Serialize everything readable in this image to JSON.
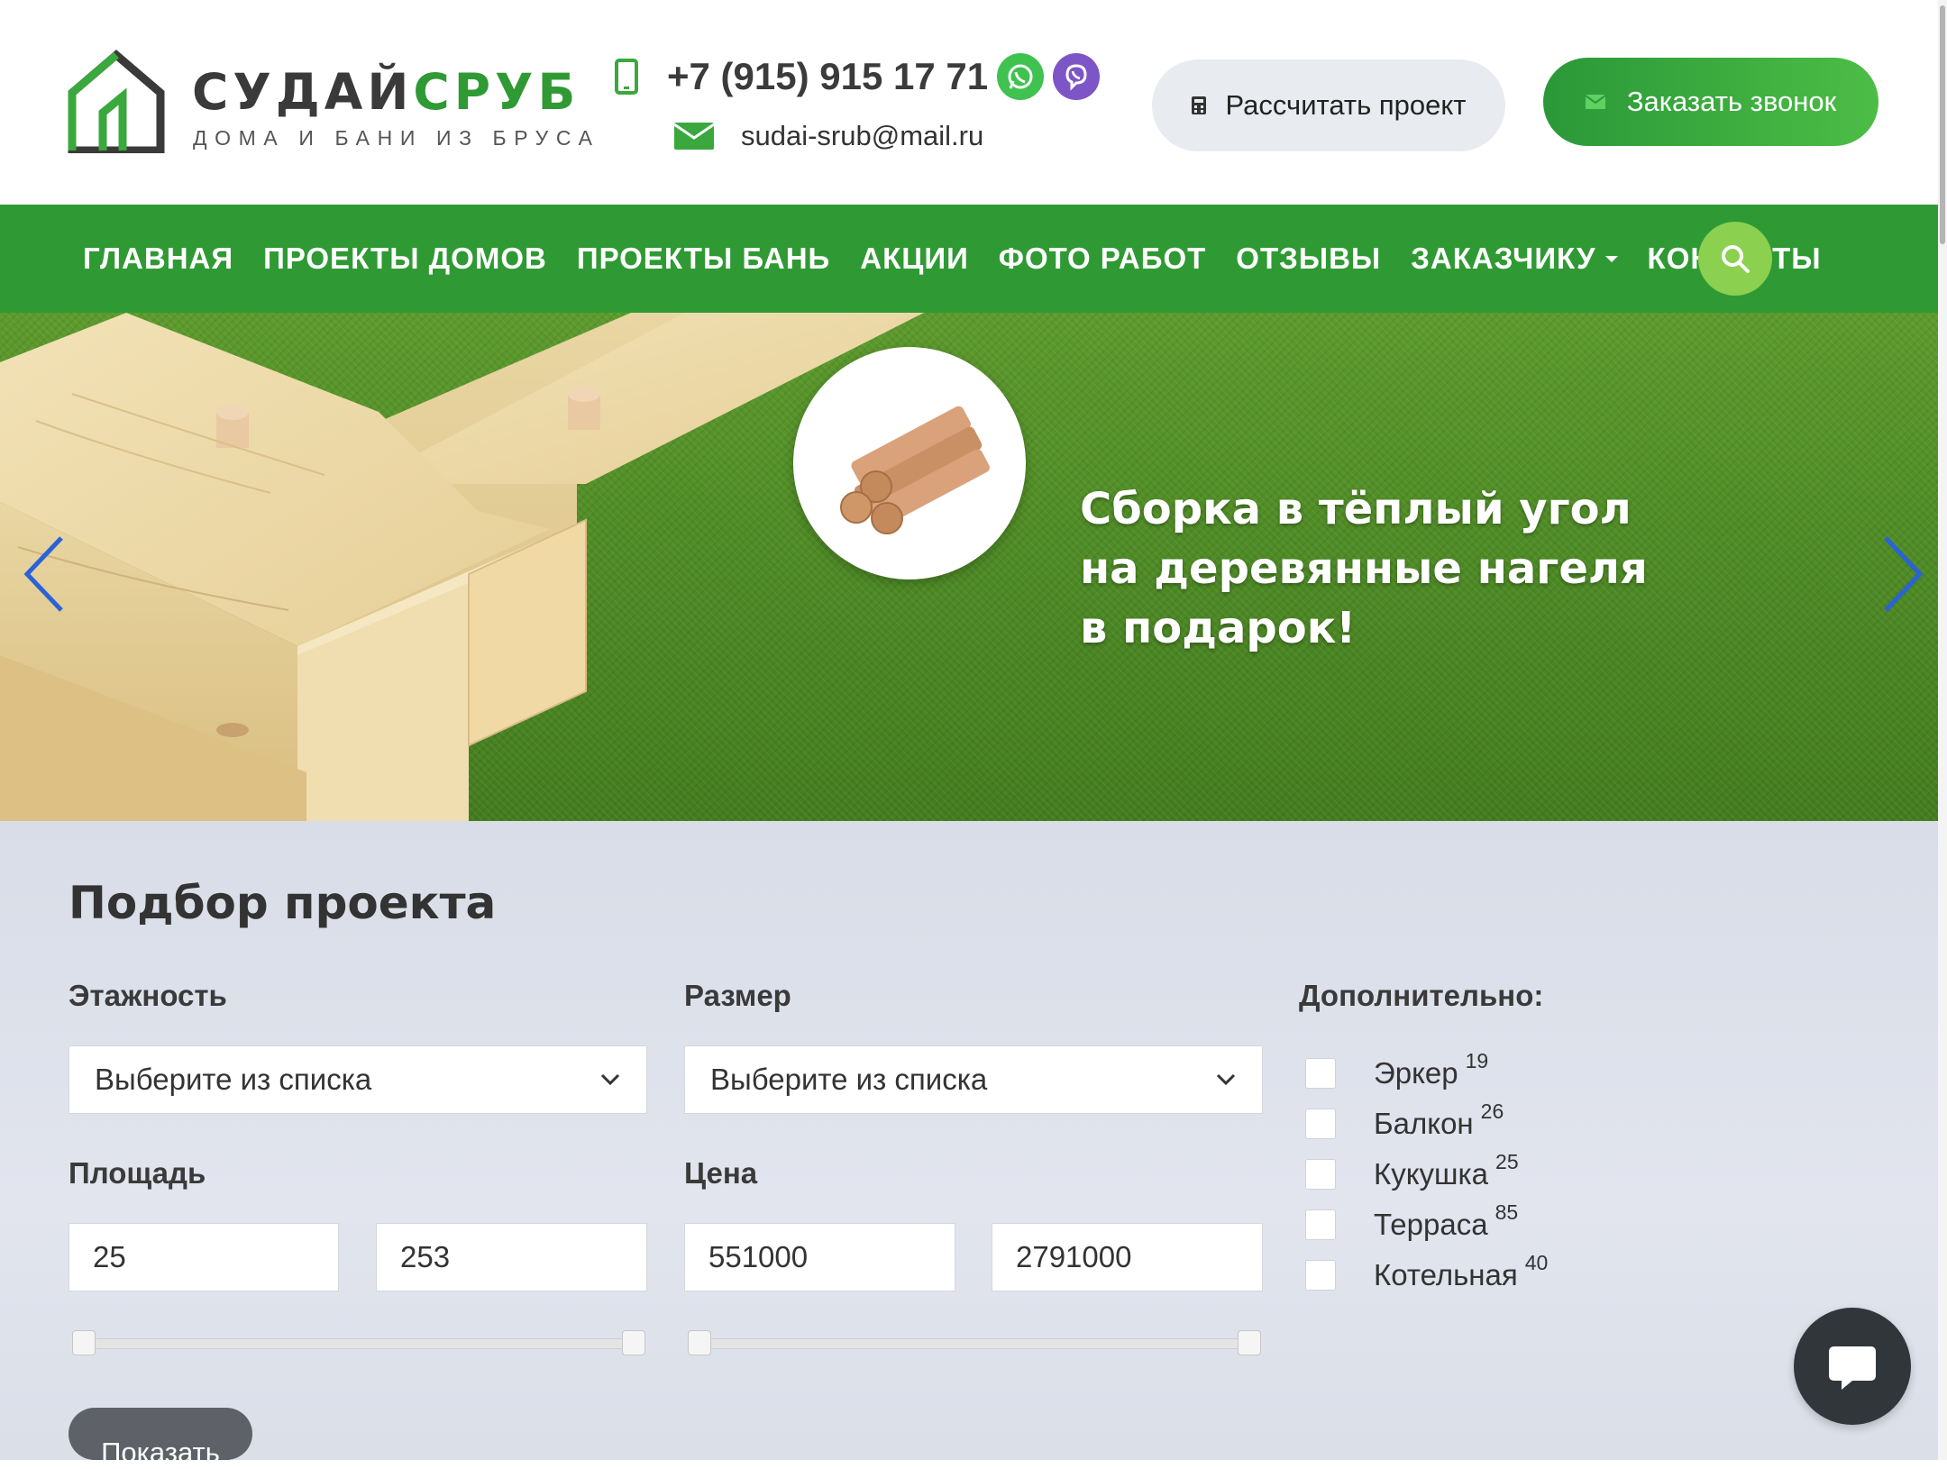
{
  "header": {
    "brand_dark": "СУДАЙ",
    "brand_green": "СРУБ",
    "tagline": "ДОМА И БАНИ ИЗ БРУСА",
    "phone": "+7 (915) 915 17 71",
    "email": "sudai-srub@mail.ru",
    "calc_button": "Рассчитать проект",
    "call_button": "Заказать звонок"
  },
  "nav": {
    "items": [
      "ГЛАВНАЯ",
      "ПРОЕКТЫ ДОМОВ",
      "ПРОЕКТЫ БАНЬ",
      "АКЦИИ",
      "ФОТО РАБОТ",
      "ОТЗЫВЫ",
      "ЗАКАЗЧИКУ",
      "КОНТАКТЫ"
    ]
  },
  "hero": {
    "lines": [
      "Сборка в тёплый угол",
      "на деревянные нагеля",
      "в подарок!"
    ]
  },
  "filter": {
    "title": "Подбор проекта",
    "floors_label": "Этажность",
    "floors_value": "Выберите из списка",
    "size_label": "Размер",
    "size_value": "Выберите из списка",
    "area_label": "Площадь",
    "area_min": "25",
    "area_max": "253",
    "price_label": "Цена",
    "price_min": "551000",
    "price_max": "2791000",
    "extras_label": "Дополнительно:",
    "extras": [
      {
        "label": "Эркер",
        "count": "19",
        "checked": false
      },
      {
        "label": "Балкон",
        "count": "26",
        "checked": false
      },
      {
        "label": "Кукушка",
        "count": "25",
        "checked": false
      },
      {
        "label": "Терраса",
        "count": "85",
        "checked": false
      },
      {
        "label": "Котельная",
        "count": "40",
        "checked": false
      }
    ],
    "show_button": "Показать"
  },
  "colors": {
    "brand_green": "#2f9a34",
    "light_green": "#8bd14f",
    "dark_text": "#3a3a3a",
    "filter_bg": "#dde1ea",
    "chat_bg": "#31363b"
  }
}
